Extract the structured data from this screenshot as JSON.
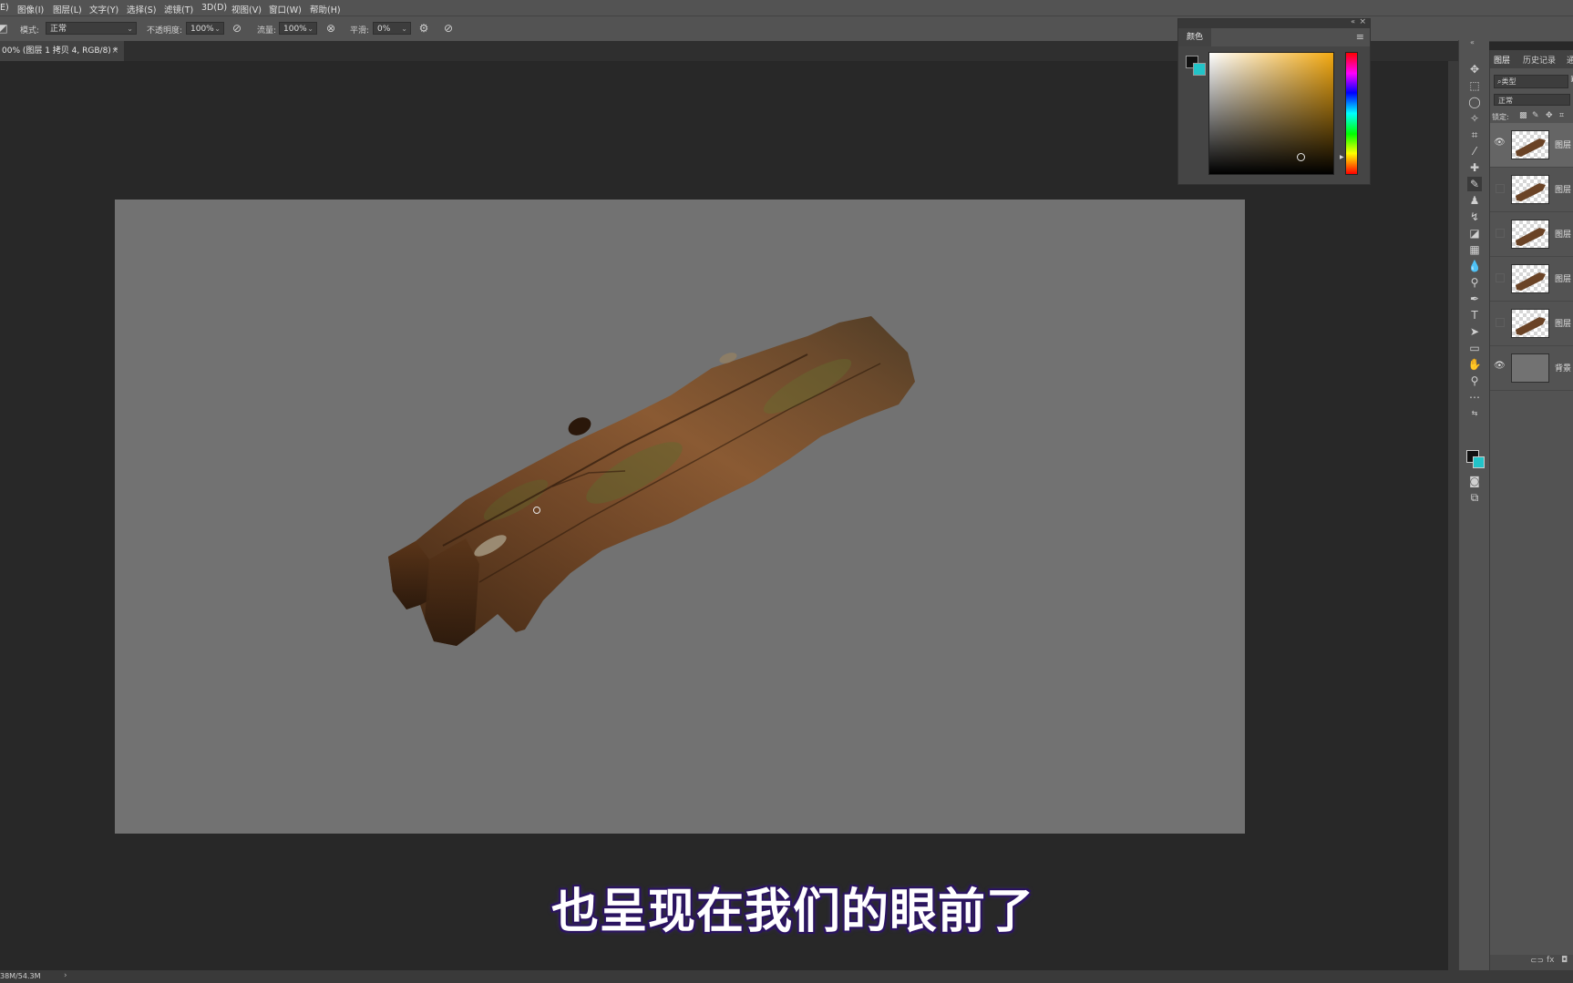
{
  "menu": {
    "items": [
      "E)",
      "图像(I)",
      "图层(L)",
      "文字(Y)",
      "选择(S)",
      "滤镜(T)",
      "3D(D)",
      "视图(V)",
      "窗口(W)",
      "帮助(H)"
    ]
  },
  "options": {
    "mode_label": "模式:",
    "mode_value": "正常",
    "opacity_label": "不透明度:",
    "opacity_value": "100%",
    "flow_label": "流量:",
    "flow_value": "100%",
    "smoothing_label": "平滑:",
    "smoothing_value": "0%"
  },
  "document_tab": {
    "title": "00% (图层 1 拷贝 4, RGB/8) *",
    "close": "×"
  },
  "color_panel": {
    "tab": "颜色",
    "foreground": "#111111",
    "background": "#22c4c8"
  },
  "layers_panel": {
    "tabs": [
      "图层",
      "历史记录",
      "通"
    ],
    "filter_label": "类型",
    "blend_mode": "正常",
    "lock_label": "锁定:",
    "layers": [
      {
        "name": "图层",
        "visible": true
      },
      {
        "name": "图层",
        "visible": false
      },
      {
        "name": "图层",
        "visible": false
      },
      {
        "name": "图层",
        "visible": false
      },
      {
        "name": "图层",
        "visible": false
      },
      {
        "name": "背景",
        "visible": true
      }
    ]
  },
  "status": {
    "doc_size": "38M/54.3M",
    "arrow": "›"
  },
  "subtitle": "也呈现在我们的眼前了"
}
